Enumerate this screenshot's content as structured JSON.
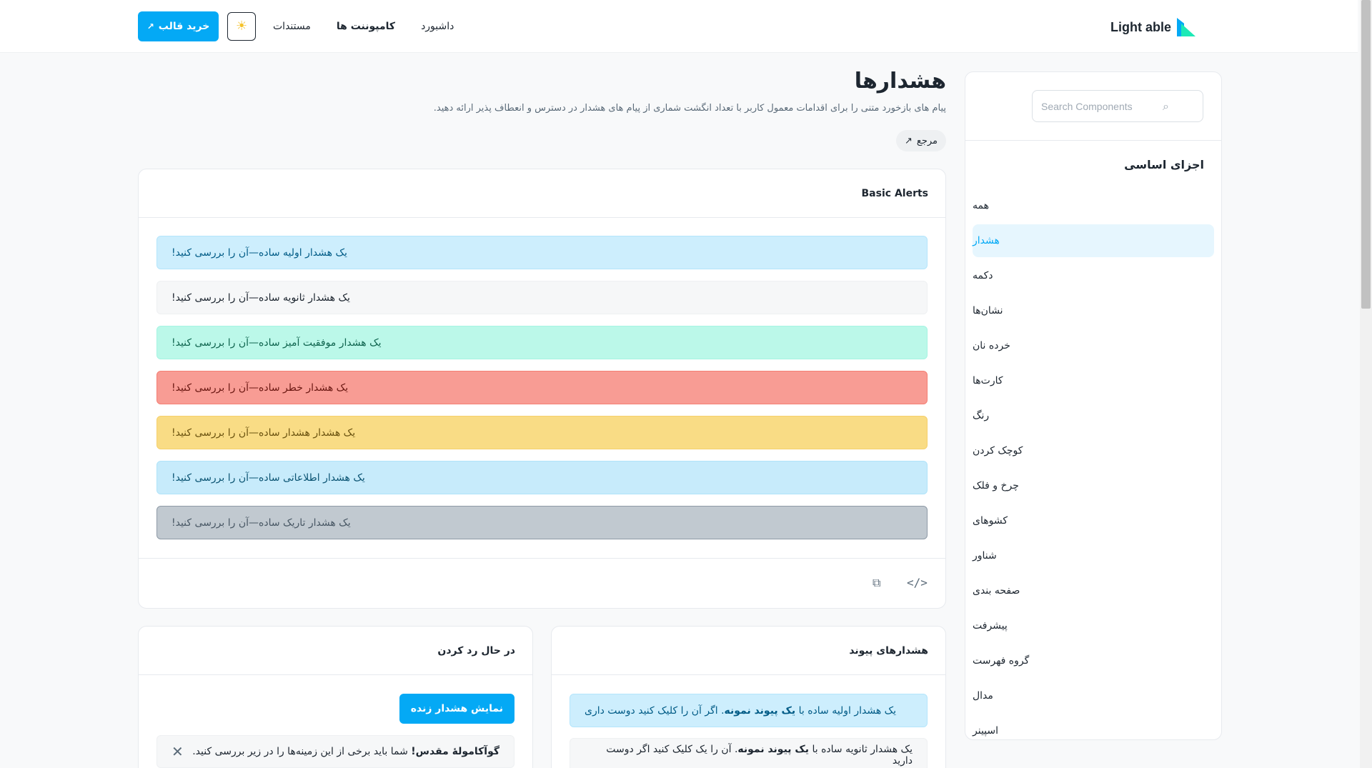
{
  "brand": {
    "name": "Light able"
  },
  "nav": {
    "links": [
      {
        "label": "داشبورد"
      },
      {
        "label": "کامپوننت ها"
      },
      {
        "label": "مستندات"
      }
    ],
    "theme_icon": "sun-icon",
    "buy_label": "خرید قالب",
    "buy_icon": "external-link-icon"
  },
  "sidebar": {
    "search_placeholder": "Search Components",
    "heading": "اجزای اساسی",
    "items": [
      {
        "label": "همه"
      },
      {
        "label": "هشدار"
      },
      {
        "label": "دکمه"
      },
      {
        "label": "نشان‌ها"
      },
      {
        "label": "خرده نان"
      },
      {
        "label": "کارت‌ها"
      },
      {
        "label": "رنگ"
      },
      {
        "label": "کوچک کردن"
      },
      {
        "label": "چرخ و فلک"
      },
      {
        "label": "کشوهای"
      },
      {
        "label": "شناور"
      },
      {
        "label": "صفحه بندی"
      },
      {
        "label": "پیشرفت"
      },
      {
        "label": "گروه فهرست"
      },
      {
        "label": "مدال"
      },
      {
        "label": "اسپینر"
      }
    ]
  },
  "page": {
    "title": "هشدارها",
    "description": "پیام های بازخورد متنی را برای اقدامات معمول کاربر با تعداد انگشت شماری از پیام های هشدار در دسترس و انعطاف پذیر ارائه دهید.",
    "reference_label": "مرجع"
  },
  "basic_alerts": {
    "title": "Basic Alerts",
    "alerts": [
      {
        "text": "یک هشدار اولیه ساده—آن را بررسی کنید!"
      },
      {
        "text": "یک هشدار ثانویه ساده—آن را بررسی کنید!"
      },
      {
        "text": "یک هشدار موفقیت آمیز ساده—آن را بررسی کنید!"
      },
      {
        "text": "یک هشدار خطر ساده—آن را بررسی کنید!"
      },
      {
        "text": "یک هشدار هشدار ساده—آن را بررسی کنید!"
      },
      {
        "text": "یک هشدار اطلاعاتی ساده—آن را بررسی کنید!"
      },
      {
        "text": "یک هشدار تاریک ساده—آن را بررسی کنید!"
      }
    ]
  },
  "dismissing": {
    "title": "در حال رد کردن",
    "live_button": "نمایش هشدار زنده",
    "alert_bold": "گوآکامولهٔ مقدس!",
    "alert_text": " شما باید برخی از این زمینه‌ها را در زیر بررسی کنید."
  },
  "link_alerts": {
    "title": "هشدارهای پیوند",
    "alerts": [
      {
        "pre": "یک هشدار اولیه ساده با ",
        "link": "یک پیوند نمونه",
        "post": ". اگر آن را کلیک کنید دوست داری"
      },
      {
        "pre": "یک هشدار ثانویه ساده با ",
        "link": "یک پیوند نمونه",
        "post": ". آن را یک کلیک کنید اگر دوست دارید"
      }
    ]
  }
}
